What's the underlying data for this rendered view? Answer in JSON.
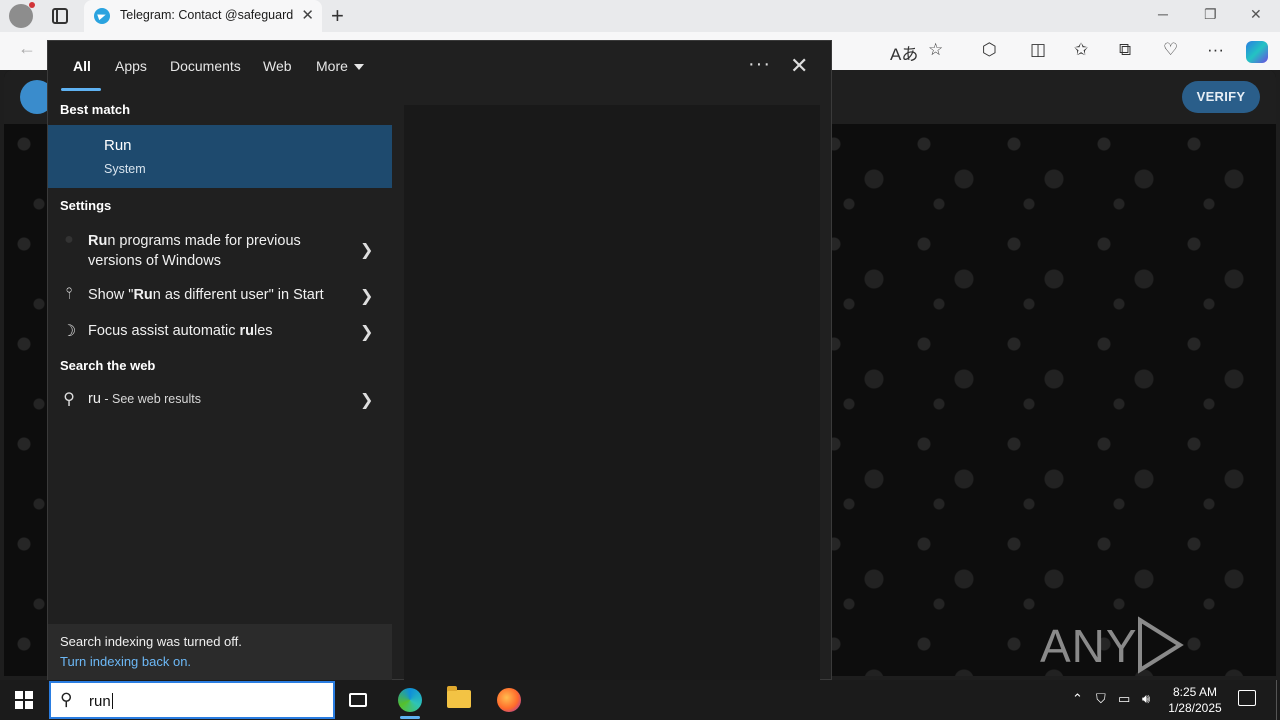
{
  "browser": {
    "tab_title": "Telegram: Contact @safeguard",
    "tab_close": "✕",
    "new_tab": "+"
  },
  "telegram": {
    "verify_label": "VERIFY",
    "watermark": "ANY RUN"
  },
  "search": {
    "tabs": [
      {
        "label": "All"
      },
      {
        "label": "Apps"
      },
      {
        "label": "Documents"
      },
      {
        "label": "Web"
      },
      {
        "label": "More"
      }
    ],
    "more_dots": "···",
    "close": "✕",
    "best_match_heading": "Best match",
    "best_match": {
      "title": "Run",
      "subtitle": "System"
    },
    "settings_heading": "Settings",
    "settings_items": [
      {
        "label": "Run programs made for previous versions of Windows"
      },
      {
        "label": "Show \"Run as different user\" in Start"
      },
      {
        "label": "Focus assist automatic rules"
      }
    ],
    "web_heading": "Search the web",
    "web_item": {
      "query": "ru",
      "suffix": " - See web results"
    },
    "indexing_notice": "Search indexing was turned off.",
    "indexing_link": "Turn indexing back on.",
    "query": "run"
  },
  "taskbar": {
    "time": "8:25 AM",
    "date": "1/28/2025"
  }
}
